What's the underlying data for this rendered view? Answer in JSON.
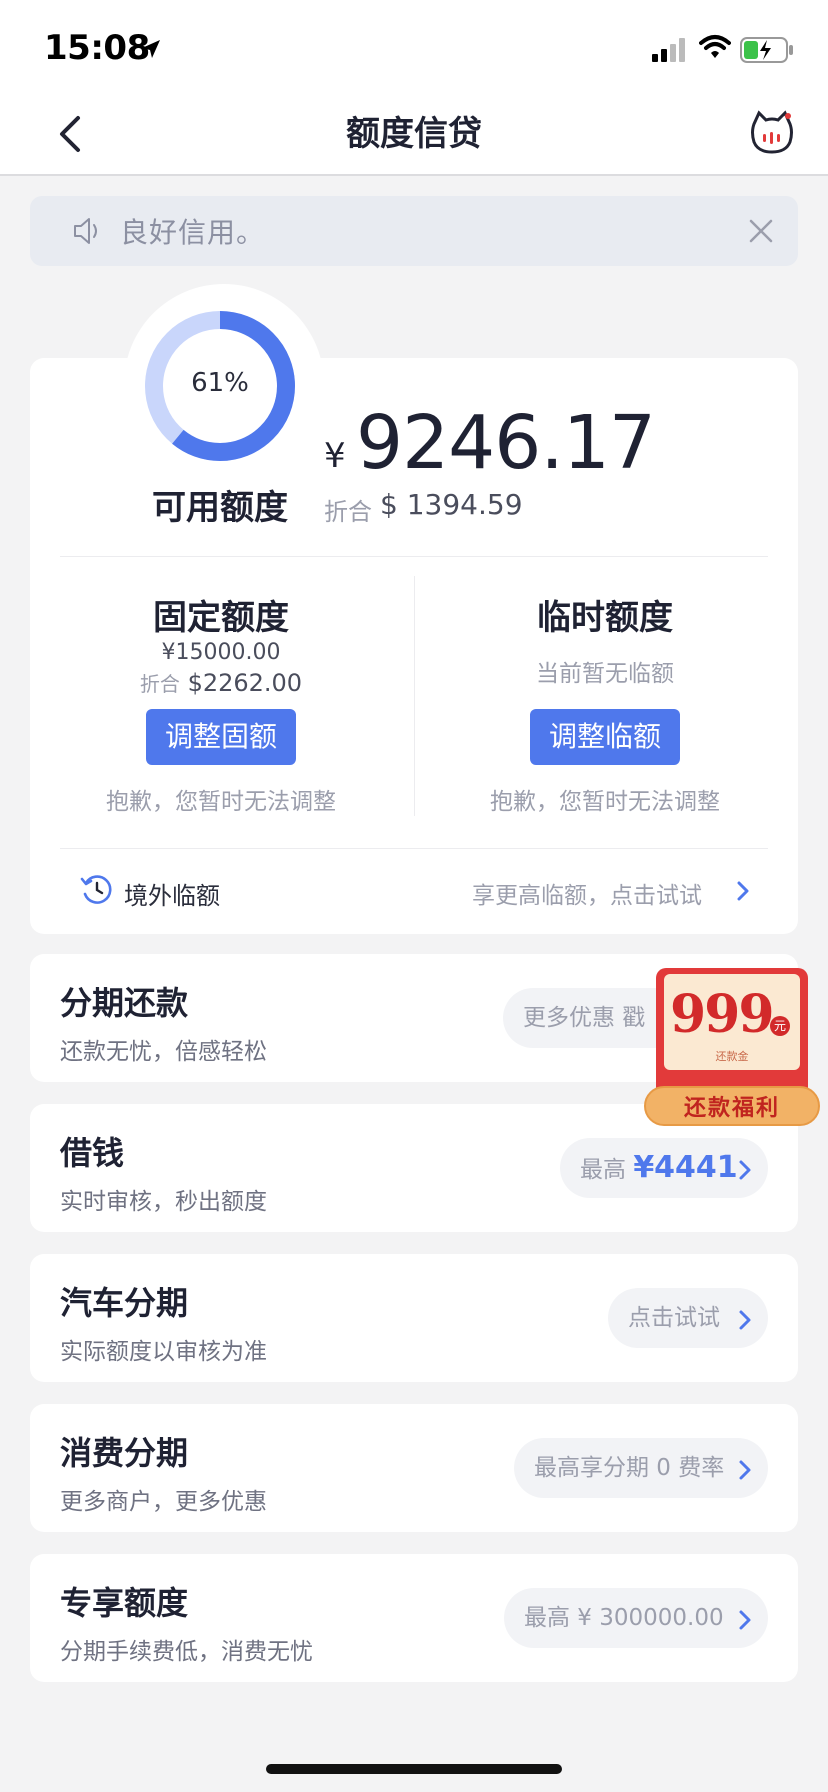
{
  "status_bar": {
    "time": "15:08"
  },
  "nav": {
    "title": "额度信贷"
  },
  "notice": {
    "text": "良好信用。"
  },
  "credit": {
    "percent_text": "61%",
    "percent_value": 0.61,
    "available_label": "可用额度",
    "currency": "¥",
    "available_amount": "9246.17",
    "fold_label": "折合",
    "fold_amount": "$ 1394.59"
  },
  "fixed": {
    "title": "固定额度",
    "amount": "¥15000.00",
    "fold_label": "折合",
    "fold_amount": "$2262.00",
    "button": "调整固额",
    "note": "抱歉，您暂时无法调整"
  },
  "temp": {
    "title": "临时额度",
    "status": "当前暂无临额",
    "button": "调整临额",
    "note": "抱歉，您暂时无法调整"
  },
  "overseas": {
    "label": "境外临额",
    "hint": "享更高临额，点击试试"
  },
  "items": [
    {
      "title": "分期还款",
      "subtitle": "还款无忧，倍感轻松",
      "pill": "更多优惠 戳"
    },
    {
      "title": "借钱",
      "subtitle": "实时审核，秒出额度",
      "pill_prefix": "最高",
      "pill_amount": "¥4441"
    },
    {
      "title": "汽车分期",
      "subtitle": "实际额度以审核为准",
      "pill": "点击试试"
    },
    {
      "title": "消费分期",
      "subtitle": "更多商户，更多优惠",
      "pill": "最高享分期 0 费率"
    },
    {
      "title": "专享额度",
      "subtitle": "分期手续费低，消费无忧",
      "pill": "最高 ¥ 300000.00"
    }
  ],
  "badge": {
    "amount": "999",
    "unit": "元",
    "small": "还款金",
    "ribbon": "还款福利"
  },
  "colors": {
    "accent": "#4f78ec",
    "ring_track": "#c9d6fb",
    "badge_red": "#e23a3a"
  }
}
